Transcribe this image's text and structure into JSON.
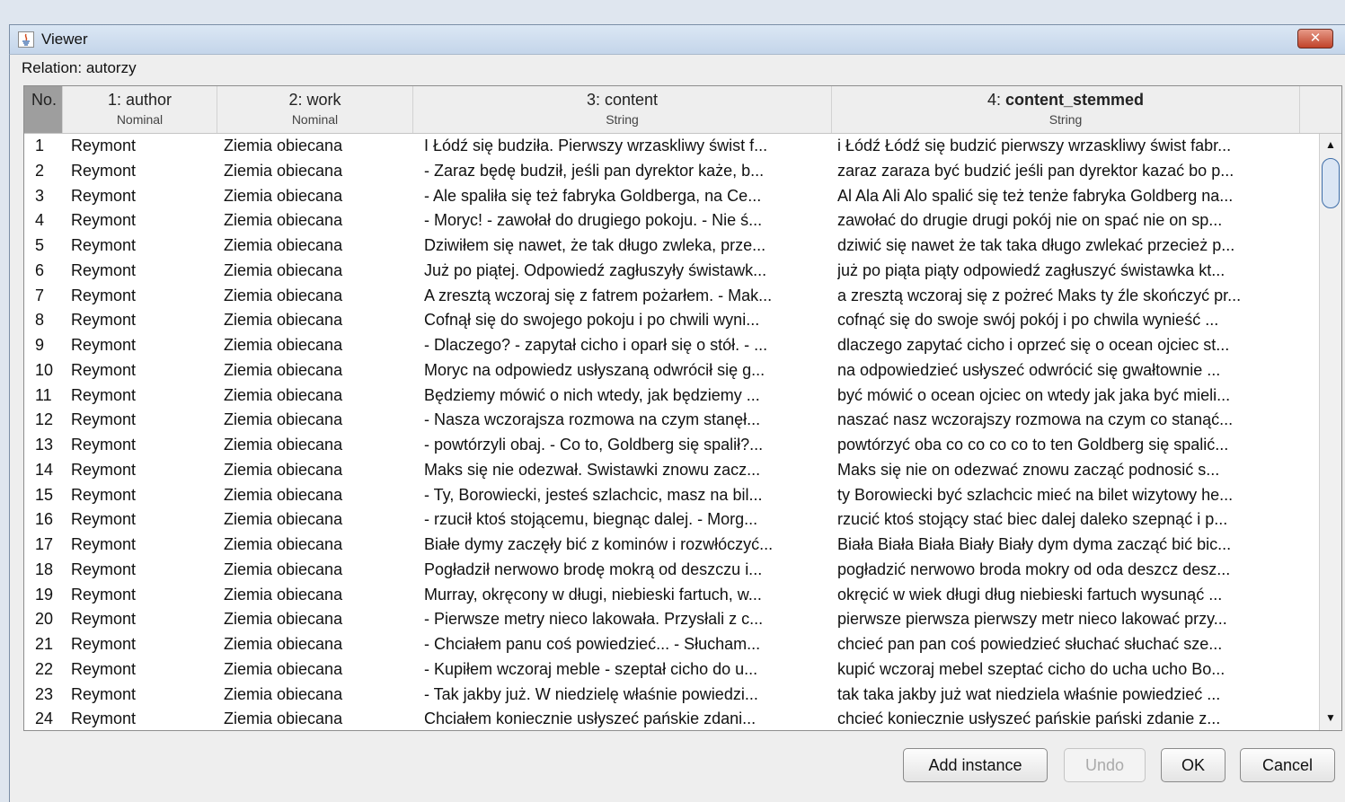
{
  "window": {
    "title": "Viewer",
    "close_label": "✕"
  },
  "relation_label": "Relation: autorzy",
  "columns": [
    {
      "name": "No.",
      "type": ""
    },
    {
      "name": "1: author",
      "type": "Nominal"
    },
    {
      "name": "2: work",
      "type": "Nominal"
    },
    {
      "name": "3: content",
      "type": "String"
    },
    {
      "prefix": "4: ",
      "name": "content_stemmed",
      "type": "String"
    }
  ],
  "rows": [
    {
      "no": "1",
      "author": "Reymont",
      "work": "Ziemia obiecana",
      "content": "I Łódź się budziła. Pierwszy wrzaskliwy świst f...",
      "stemmed": "i Łódź Łódź się budzić pierwszy wrzaskliwy świst fabr..."
    },
    {
      "no": "2",
      "author": "Reymont",
      "work": "Ziemia obiecana",
      "content": "- Zaraz będę budził, jeśli pan dyrektor każe, b...",
      "stemmed": "zaraz zaraza być budzić jeśli pan dyrektor kazać bo p..."
    },
    {
      "no": "3",
      "author": "Reymont",
      "work": "Ziemia obiecana",
      "content": "- Ale spaliła się też fabryka Goldberga, na Ce...",
      "stemmed": "Al Ala Ali Alo spalić się też tenże fabryka Goldberg na..."
    },
    {
      "no": "4",
      "author": "Reymont",
      "work": "Ziemia obiecana",
      "content": "- Moryc! - zawołał do drugiego pokoju. - Nie ś...",
      "stemmed": "zawołać do drugie drugi pokój nie on spać nie on sp..."
    },
    {
      "no": "5",
      "author": "Reymont",
      "work": "Ziemia obiecana",
      "content": "Dziwiłem się nawet, że tak długo zwleka, prze...",
      "stemmed": "dziwić się nawet że tak taka długo zwlekać przecież p..."
    },
    {
      "no": "6",
      "author": "Reymont",
      "work": "Ziemia obiecana",
      "content": "Już po piątej. Odpowiedź zagłuszyły świstawk...",
      "stemmed": "już po piąta piąty odpowiedź zagłuszyć świstawka kt..."
    },
    {
      "no": "7",
      "author": "Reymont",
      "work": "Ziemia obiecana",
      "content": "A zresztą wczoraj się z fatrem pożarłem. - Mak...",
      "stemmed": "a zresztą wczoraj się z pożreć Maks ty źle skończyć pr..."
    },
    {
      "no": "8",
      "author": "Reymont",
      "work": "Ziemia obiecana",
      "content": "Cofnął się do swojego pokoju i po chwili wyni...",
      "stemmed": "cofnąć się do swoje swój pokój i po chwila wynieść ..."
    },
    {
      "no": "9",
      "author": "Reymont",
      "work": "Ziemia obiecana",
      "content": "- Dlaczego? - zapytał cicho i oparł się o stół. - ...",
      "stemmed": "dlaczego zapytać cicho i oprzeć się o ocean ojciec st..."
    },
    {
      "no": "10",
      "author": "Reymont",
      "work": "Ziemia obiecana",
      "content": "Moryc na odpowiedz usłyszaną odwrócił się g...",
      "stemmed": "na odpowiedzieć usłyszeć odwrócić się gwałtownie ..."
    },
    {
      "no": "11",
      "author": "Reymont",
      "work": "Ziemia obiecana",
      "content": "Będziemy mówić o nich wtedy, jak będziemy ...",
      "stemmed": "być mówić o ocean ojciec on wtedy jak jaka być mieli..."
    },
    {
      "no": "12",
      "author": "Reymont",
      "work": "Ziemia obiecana",
      "content": "- Nasza wczorajsza rozmowa na czym stanęł...",
      "stemmed": "naszać nasz wczorajszy rozmowa na czym co stanąć..."
    },
    {
      "no": "13",
      "author": "Reymont",
      "work": "Ziemia obiecana",
      "content": "- powtórzyli obaj. - Co to, Goldberg się spalił?...",
      "stemmed": "powtórzyć oba co co co co to ten Goldberg się spalić..."
    },
    {
      "no": "14",
      "author": "Reymont",
      "work": "Ziemia obiecana",
      "content": "Maks się nie odezwał. Swistawki znowu zacz...",
      "stemmed": "Maks się nie on odezwać znowu zacząć podnosić s..."
    },
    {
      "no": "15",
      "author": "Reymont",
      "work": "Ziemia obiecana",
      "content": "- Ty, Borowiecki, jesteś szlachcic, masz na bil...",
      "stemmed": "ty Borowiecki być szlachcic mieć na bilet wizytowy he..."
    },
    {
      "no": "16",
      "author": "Reymont",
      "work": "Ziemia obiecana",
      "content": "- rzucił ktoś stojącemu, biegnąc dalej. - Morg...",
      "stemmed": "rzucić ktoś stojący stać biec dalej daleko szepnąć i p..."
    },
    {
      "no": "17",
      "author": "Reymont",
      "work": "Ziemia obiecana",
      "content": "Białe dymy zaczęły bić z kominów i rozwłóczyć...",
      "stemmed": "Biała Biała Biała Biały Biały dym dyma zacząć bić bic..."
    },
    {
      "no": "18",
      "author": "Reymont",
      "work": "Ziemia obiecana",
      "content": "Pogładził nerwowo brodę mokrą od deszczu i...",
      "stemmed": "pogładzić nerwowo broda mokry od oda deszcz desz..."
    },
    {
      "no": "19",
      "author": "Reymont",
      "work": "Ziemia obiecana",
      "content": "Murray, okręcony w długi, niebieski fartuch, w...",
      "stemmed": "okręcić w wiek długi dług niebieski fartuch wysunąć ..."
    },
    {
      "no": "20",
      "author": "Reymont",
      "work": "Ziemia obiecana",
      "content": "- Pierwsze metry nieco lakowała. Przysłali z c...",
      "stemmed": "pierwsze pierwsza pierwszy metr nieco lakować przy..."
    },
    {
      "no": "21",
      "author": "Reymont",
      "work": "Ziemia obiecana",
      "content": "- Chciałem panu coś powiedzieć... - Słucham...",
      "stemmed": "chcieć pan pan coś powiedzieć słuchać słuchać sze..."
    },
    {
      "no": "22",
      "author": "Reymont",
      "work": "Ziemia obiecana",
      "content": "- Kupiłem wczoraj meble - szeptał cicho do u...",
      "stemmed": "kupić wczoraj mebel szeptać cicho do ucha ucho Bo..."
    },
    {
      "no": "23",
      "author": "Reymont",
      "work": "Ziemia obiecana",
      "content": "- Tak jakby już. W niedzielę właśnie powiedzi...",
      "stemmed": "tak taka jakby już wat niedziela właśnie powiedzieć ..."
    },
    {
      "no": "24",
      "author": "Reymont",
      "work": "Ziemia obiecana",
      "content": "Chciałem koniecznie usłyszeć pańskie zdani...",
      "stemmed": "chcieć koniecznie usłyszeć pańskie pański zdanie z..."
    }
  ],
  "scroll": {
    "up": "▲",
    "down": "▼"
  },
  "buttons": {
    "add_instance": "Add instance",
    "undo": "Undo",
    "ok": "OK",
    "cancel": "Cancel"
  }
}
